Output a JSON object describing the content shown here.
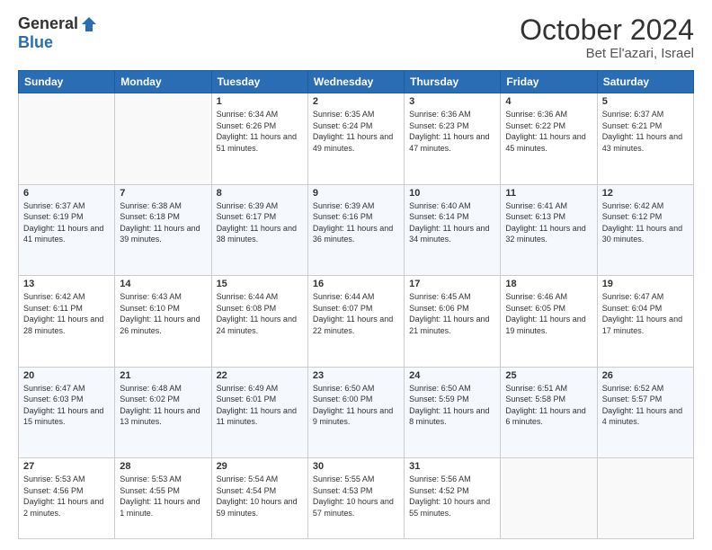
{
  "header": {
    "logo_general": "General",
    "logo_blue": "Blue",
    "month": "October 2024",
    "location": "Bet El'azari, Israel"
  },
  "days_of_week": [
    "Sunday",
    "Monday",
    "Tuesday",
    "Wednesday",
    "Thursday",
    "Friday",
    "Saturday"
  ],
  "weeks": [
    {
      "shade": false,
      "days": [
        {
          "num": "",
          "info": ""
        },
        {
          "num": "",
          "info": ""
        },
        {
          "num": "1",
          "info": "Sunrise: 6:34 AM\nSunset: 6:26 PM\nDaylight: 11 hours and 51 minutes."
        },
        {
          "num": "2",
          "info": "Sunrise: 6:35 AM\nSunset: 6:24 PM\nDaylight: 11 hours and 49 minutes."
        },
        {
          "num": "3",
          "info": "Sunrise: 6:36 AM\nSunset: 6:23 PM\nDaylight: 11 hours and 47 minutes."
        },
        {
          "num": "4",
          "info": "Sunrise: 6:36 AM\nSunset: 6:22 PM\nDaylight: 11 hours and 45 minutes."
        },
        {
          "num": "5",
          "info": "Sunrise: 6:37 AM\nSunset: 6:21 PM\nDaylight: 11 hours and 43 minutes."
        }
      ]
    },
    {
      "shade": true,
      "days": [
        {
          "num": "6",
          "info": "Sunrise: 6:37 AM\nSunset: 6:19 PM\nDaylight: 11 hours and 41 minutes."
        },
        {
          "num": "7",
          "info": "Sunrise: 6:38 AM\nSunset: 6:18 PM\nDaylight: 11 hours and 39 minutes."
        },
        {
          "num": "8",
          "info": "Sunrise: 6:39 AM\nSunset: 6:17 PM\nDaylight: 11 hours and 38 minutes."
        },
        {
          "num": "9",
          "info": "Sunrise: 6:39 AM\nSunset: 6:16 PM\nDaylight: 11 hours and 36 minutes."
        },
        {
          "num": "10",
          "info": "Sunrise: 6:40 AM\nSunset: 6:14 PM\nDaylight: 11 hours and 34 minutes."
        },
        {
          "num": "11",
          "info": "Sunrise: 6:41 AM\nSunset: 6:13 PM\nDaylight: 11 hours and 32 minutes."
        },
        {
          "num": "12",
          "info": "Sunrise: 6:42 AM\nSunset: 6:12 PM\nDaylight: 11 hours and 30 minutes."
        }
      ]
    },
    {
      "shade": false,
      "days": [
        {
          "num": "13",
          "info": "Sunrise: 6:42 AM\nSunset: 6:11 PM\nDaylight: 11 hours and 28 minutes."
        },
        {
          "num": "14",
          "info": "Sunrise: 6:43 AM\nSunset: 6:10 PM\nDaylight: 11 hours and 26 minutes."
        },
        {
          "num": "15",
          "info": "Sunrise: 6:44 AM\nSunset: 6:08 PM\nDaylight: 11 hours and 24 minutes."
        },
        {
          "num": "16",
          "info": "Sunrise: 6:44 AM\nSunset: 6:07 PM\nDaylight: 11 hours and 22 minutes."
        },
        {
          "num": "17",
          "info": "Sunrise: 6:45 AM\nSunset: 6:06 PM\nDaylight: 11 hours and 21 minutes."
        },
        {
          "num": "18",
          "info": "Sunrise: 6:46 AM\nSunset: 6:05 PM\nDaylight: 11 hours and 19 minutes."
        },
        {
          "num": "19",
          "info": "Sunrise: 6:47 AM\nSunset: 6:04 PM\nDaylight: 11 hours and 17 minutes."
        }
      ]
    },
    {
      "shade": true,
      "days": [
        {
          "num": "20",
          "info": "Sunrise: 6:47 AM\nSunset: 6:03 PM\nDaylight: 11 hours and 15 minutes."
        },
        {
          "num": "21",
          "info": "Sunrise: 6:48 AM\nSunset: 6:02 PM\nDaylight: 11 hours and 13 minutes."
        },
        {
          "num": "22",
          "info": "Sunrise: 6:49 AM\nSunset: 6:01 PM\nDaylight: 11 hours and 11 minutes."
        },
        {
          "num": "23",
          "info": "Sunrise: 6:50 AM\nSunset: 6:00 PM\nDaylight: 11 hours and 9 minutes."
        },
        {
          "num": "24",
          "info": "Sunrise: 6:50 AM\nSunset: 5:59 PM\nDaylight: 11 hours and 8 minutes."
        },
        {
          "num": "25",
          "info": "Sunrise: 6:51 AM\nSunset: 5:58 PM\nDaylight: 11 hours and 6 minutes."
        },
        {
          "num": "26",
          "info": "Sunrise: 6:52 AM\nSunset: 5:57 PM\nDaylight: 11 hours and 4 minutes."
        }
      ]
    },
    {
      "shade": false,
      "days": [
        {
          "num": "27",
          "info": "Sunrise: 5:53 AM\nSunset: 4:56 PM\nDaylight: 11 hours and 2 minutes."
        },
        {
          "num": "28",
          "info": "Sunrise: 5:53 AM\nSunset: 4:55 PM\nDaylight: 11 hours and 1 minute."
        },
        {
          "num": "29",
          "info": "Sunrise: 5:54 AM\nSunset: 4:54 PM\nDaylight: 10 hours and 59 minutes."
        },
        {
          "num": "30",
          "info": "Sunrise: 5:55 AM\nSunset: 4:53 PM\nDaylight: 10 hours and 57 minutes."
        },
        {
          "num": "31",
          "info": "Sunrise: 5:56 AM\nSunset: 4:52 PM\nDaylight: 10 hours and 55 minutes."
        },
        {
          "num": "",
          "info": ""
        },
        {
          "num": "",
          "info": ""
        }
      ]
    }
  ]
}
